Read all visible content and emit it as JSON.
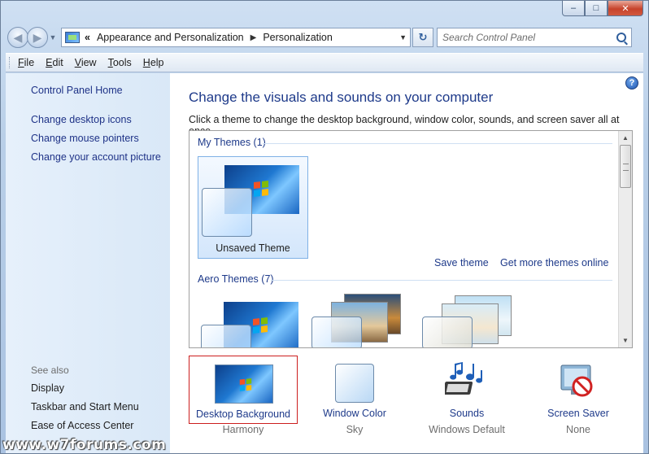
{
  "window": {
    "minimize_glyph": "–",
    "maximize_glyph": "□",
    "close_glyph": "✕"
  },
  "address_bar": {
    "prefix": "«",
    "breadcrumbs": [
      "Appearance and Personalization",
      "Personalization"
    ],
    "separator": "▶",
    "search_placeholder": "Search Control Panel"
  },
  "menu": {
    "items": [
      "File",
      "Edit",
      "View",
      "Tools",
      "Help"
    ]
  },
  "sidebar": {
    "home": "Control Panel Home",
    "links": [
      "Change desktop icons",
      "Change mouse pointers",
      "Change your account picture"
    ],
    "see_also_label": "See also",
    "see_also": [
      "Display",
      "Taskbar and Start Menu",
      "Ease of Access Center"
    ]
  },
  "main": {
    "help_glyph": "?",
    "title": "Change the visuals and sounds on your computer",
    "subtitle": "Click a theme to change the desktop background, window color, sounds, and screen saver all at once.",
    "my_themes_header": "My Themes (1)",
    "unsaved_theme_label": "Unsaved Theme",
    "save_theme": "Save theme",
    "get_more_themes": "Get more themes online",
    "aero_themes_header": "Aero Themes (7)"
  },
  "bottom": {
    "desktop_background": {
      "label": "Desktop Background",
      "value": "Harmony"
    },
    "window_color": {
      "label": "Window Color",
      "value": "Sky"
    },
    "sounds": {
      "label": "Sounds",
      "value": "Windows Default"
    },
    "screen_saver": {
      "label": "Screen Saver",
      "value": "None"
    }
  },
  "watermark": "www.w7forums.com",
  "colors": {
    "link": "#1e3a8a",
    "selection_border": "#cc1e1e",
    "sidebar_bg": "#dce9f8"
  }
}
